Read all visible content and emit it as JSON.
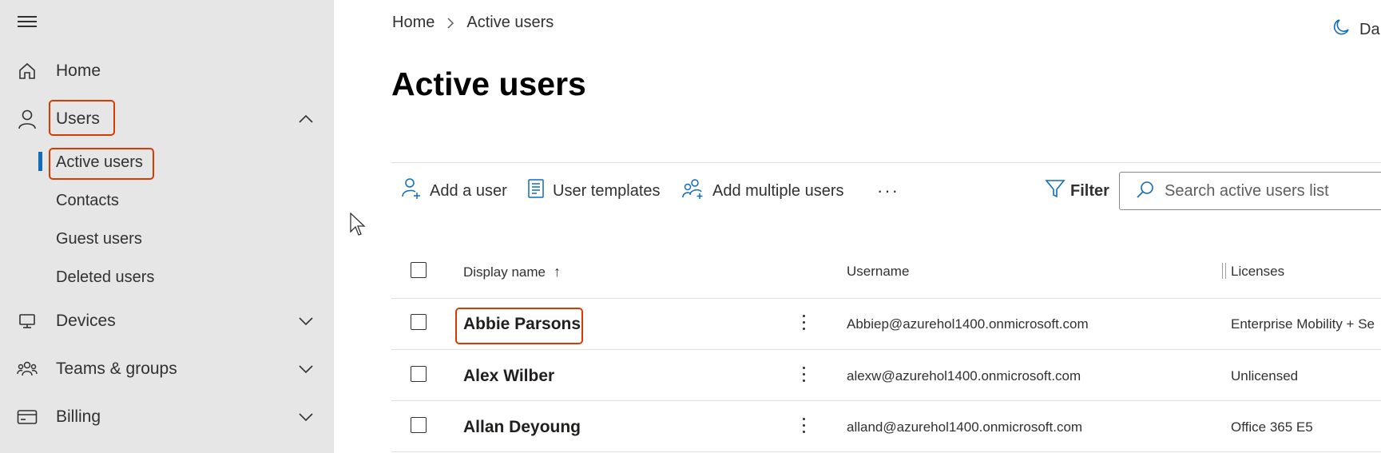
{
  "sidebar": {
    "items": [
      {
        "label": "Home",
        "icon": "home-icon"
      },
      {
        "label": "Users",
        "icon": "user-icon",
        "expanded": true,
        "children": [
          "Active users",
          "Contacts",
          "Guest users",
          "Deleted users"
        ]
      },
      {
        "label": "Devices",
        "icon": "device-icon",
        "expanded": false
      },
      {
        "label": "Teams & groups",
        "icon": "teams-icon",
        "expanded": false
      },
      {
        "label": "Billing",
        "icon": "billing-icon",
        "expanded": false
      }
    ]
  },
  "header": {
    "breadcrumb": [
      "Home",
      "Active users"
    ],
    "dark_mode_label": "Da"
  },
  "main": {
    "title": "Active users",
    "toolbar": {
      "add_user": "Add a user",
      "user_templates": "User templates",
      "add_multiple": "Add multiple users",
      "more": "···",
      "filter": "Filter"
    },
    "search": {
      "placeholder": "Search active users list"
    },
    "table": {
      "columns": [
        "Display name",
        "Username",
        "Licenses"
      ],
      "sort_indicator": "↑",
      "rows": [
        {
          "name": "Abbie Parsons",
          "username": "Abbiep@azurehol1400.onmicrosoft.com",
          "license": "Enterprise Mobility + Se"
        },
        {
          "name": "Alex Wilber",
          "username": "alexw@azurehol1400.onmicrosoft.com",
          "license": "Unlicensed"
        },
        {
          "name": "Allan Deyoung",
          "username": "alland@azurehol1400.onmicrosoft.com",
          "license": "Office 365 E5"
        }
      ]
    }
  },
  "colors": {
    "accent": "#0f6cbd",
    "highlight": "#d83b01",
    "sidebar_bg": "#e6e6e6"
  }
}
